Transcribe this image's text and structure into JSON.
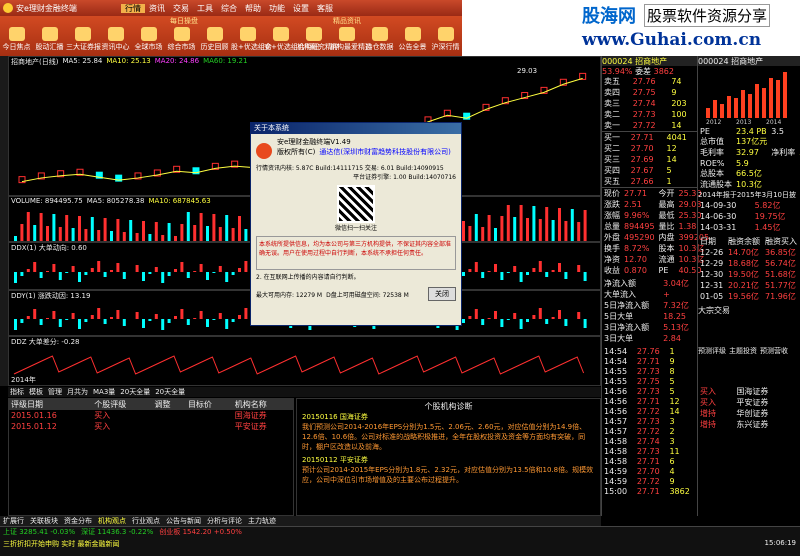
{
  "app": {
    "title": "安e理财金融终端",
    "menus": [
      "行情",
      "资讯",
      "交易",
      "工具",
      "综合",
      "帮助",
      "功能",
      "设置",
      "客服"
    ],
    "active_menu": "行情",
    "right_btns": [
      "交",
      "统",
      "云",
      "短",
      "网",
      "音"
    ]
  },
  "toolbar": {
    "sections": [
      "每日操盘",
      "精品资讯"
    ],
    "buttons": [
      "今日焦点",
      "股动汇播",
      "三大证券报",
      "资讯中心",
      "全球市场",
      "综合市场",
      "历史回顾",
      "股+优选组合",
      "安+优选组合明细",
      "机构研究精粹",
      "机构最爱精选",
      "持仓数据",
      "公告全景",
      "沪深行情"
    ]
  },
  "watermark": {
    "main": "股海网",
    "slogan": "股票软件资源分享",
    "url": "www.Guhai.com.cn"
  },
  "chart": {
    "stock": "招商地产(日线)",
    "ma": [
      "MA5: 25.84",
      "MA10: 25.13",
      "MA20: 24.86",
      "MA60: 19.21"
    ],
    "price_high": "29.03",
    "vol_label": "VOLUME: 894495.75",
    "vol_ma": [
      "MA5: 805278.38",
      "MA10: 687845.63"
    ],
    "ddx": "DDX(1) 大单动向: 0.60",
    "ddy": "DDY(1) 涨跌动因: 13.19",
    "ddz": "DDZ 大单差分: -0.28",
    "year": "2014年"
  },
  "chart_data": {
    "type": "line",
    "series": [
      {
        "name": "",
        "values": [
          15,
          15.5,
          15.8,
          16,
          15.6,
          15.2,
          15.5,
          15.9,
          16.4,
          16.2,
          16.8,
          17.1,
          16.9,
          17.5,
          18.2,
          18.8,
          18.5,
          19.4,
          20.5,
          21.2,
          22,
          23.1,
          24,
          23.6,
          24.8,
          25.7,
          26.4,
          27.1,
          28.2,
          29
        ]
      }
    ],
    "ylim": [
      14,
      30
    ]
  },
  "tabs": {
    "items": [
      "指标",
      "模板",
      "管理",
      "月共为",
      "MA3量",
      "20天全量",
      "20天全量"
    ]
  },
  "grid": {
    "headers": [
      "评级日期",
      "个股评级",
      "调整",
      "目标价",
      "机构名称"
    ],
    "rows": [
      [
        "2015.01.16",
        "买入",
        "",
        "",
        "国海证券"
      ],
      [
        "2015.01.12",
        "买入",
        "",
        "",
        "平安证券"
      ]
    ]
  },
  "report": {
    "header": "个股机构诊断",
    "items": [
      {
        "date": "20150116",
        "org": "国海证券",
        "text": "我们预测公司2014-2016年EPS分别为1.5元、2.06元、2.60元，对应估值分别为14.9倍、12.6倍、10.6倍。公司对标准的战略积极推进，全年在股权投资及资金等方面均有突破，同时，棚户区改造以及前海。"
      },
      {
        "date": "20150112",
        "org": "平安证券",
        "text": "预计公司2014-2015年EPS分别为1.8元、2.32元，对应估值分别为13.5倍和10.8倍。规模效应，公司中深位引市场增值及的主要公布过程提升。"
      }
    ]
  },
  "dialog": {
    "title": "关于本系统",
    "product": "安e理财金融终端V1.49",
    "version_label": "版权所有(C)",
    "company": "通达信(深圳市财富趋势科技股份有限公司)",
    "info": "行情资讯内核: 5.87C Build:14111715 交易: 6.01 Build:14090915",
    "platform": "平台证券引擎: 1.00 Build:14070716",
    "qr_label": "微信扫一扫关注",
    "legal": "本系统所提供信息，均为本公司与第三方机构提供，不保证其内容全部准确无误。用户在使用过程中自行判断，本系统不承担任何责任。",
    "notice": "2. 在互联网上传播的内容请自行判断。",
    "mem": "最大可用内存: 12279 M",
    "disk": "D盘上可用磁盘空间: 72538 M",
    "close_btn": "关闭"
  },
  "quote": {
    "code": "000024",
    "name": "招商地产",
    "price": "53.94%",
    "tag": "委差",
    "tag_val": "3862",
    "sell": [
      [
        "卖五",
        "27.76",
        "74"
      ],
      [
        "卖四",
        "27.75",
        "9"
      ],
      [
        "卖三",
        "27.74",
        "203"
      ],
      [
        "卖二",
        "27.73",
        "100"
      ],
      [
        "卖一",
        "27.72",
        "14"
      ]
    ],
    "buy": [
      [
        "买一",
        "27.71",
        "4041"
      ],
      [
        "买二",
        "27.70",
        "12"
      ],
      [
        "买三",
        "27.69",
        "14"
      ],
      [
        "买四",
        "27.67",
        "5"
      ],
      [
        "买五",
        "27.66",
        "1"
      ]
    ],
    "stats": [
      [
        "现价",
        "27.71",
        "今开",
        "25.30"
      ],
      [
        "涨跌",
        "2.51",
        "最高",
        "29.03"
      ],
      [
        "涨幅",
        "9.96%",
        "最低",
        "25.30"
      ],
      [
        "总量",
        "894495",
        "量比",
        "1.38"
      ],
      [
        "外盘",
        "495290",
        "内盘",
        "399205"
      ],
      [
        "换手",
        "8.72%",
        "股本",
        "10.3亿"
      ],
      [
        "净资",
        "12.70",
        "流通",
        "10.3亿"
      ],
      [
        "收益",
        "0.870",
        "PE",
        "40.50"
      ]
    ],
    "flow": [
      [
        "净流入额",
        "3.04亿"
      ],
      [
        "大单流入",
        "+"
      ],
      [
        "5日净流入额",
        "7.32亿"
      ],
      [
        "5日大单",
        "18.25"
      ],
      [
        "3日净流入额",
        "5.13亿"
      ],
      [
        "3日大单",
        "2.84"
      ]
    ]
  },
  "ticks": [
    [
      "14:54",
      "27.76",
      "1"
    ],
    [
      "14:54",
      "27.71",
      "9"
    ],
    [
      "14:55",
      "27.73",
      "8"
    ],
    [
      "14:55",
      "27.75",
      "5"
    ],
    [
      "14:56",
      "27.73",
      "5"
    ],
    [
      "14:56",
      "27.71",
      "12"
    ],
    [
      "14:56",
      "27.72",
      "14"
    ],
    [
      "14:57",
      "27.73",
      "3"
    ],
    [
      "14:57",
      "27.72",
      "2"
    ],
    [
      "14:58",
      "27.74",
      "3"
    ],
    [
      "14:58",
      "27.73",
      "11"
    ],
    [
      "14:58",
      "27.71",
      "6"
    ],
    [
      "14:59",
      "27.70",
      "4"
    ],
    [
      "14:59",
      "27.72",
      "9"
    ],
    [
      "15:00",
      "27.71",
      "3862"
    ]
  ],
  "fin": {
    "code": "000024",
    "name": "招商地产",
    "years": [
      "2012",
      "2013",
      "2014"
    ],
    "rows": [
      [
        "PE",
        "23.4 PB",
        "3.5"
      ],
      [
        "总市值",
        "137亿元"
      ],
      [
        "毛利率",
        "32.97",
        "净利率",
        "36"
      ],
      [
        "ROE%",
        "5.9"
      ],
      [
        "总股本",
        "66.5亿"
      ],
      [
        "流通股本",
        "10.3亿"
      ]
    ],
    "event": "2014年报于2015年3月10日披露",
    "table": [
      [
        "14-09-30",
        "5.82亿"
      ],
      [
        "14-06-30",
        "19.75亿"
      ],
      [
        "14-03-31",
        "1.45亿"
      ]
    ],
    "margin_headers": [
      "日期",
      "融资余额",
      "融资买入"
    ],
    "margin": [
      [
        "12-26",
        "14.70亿",
        "36.85亿"
      ],
      [
        "12-29",
        "18.68亿",
        "56.74亿"
      ],
      [
        "12-30",
        "19.50亿",
        "51.68亿"
      ],
      [
        "12-31",
        "20.21亿",
        "51.77亿"
      ],
      [
        "01-05",
        "19.56亿",
        "71.96亿"
      ]
    ],
    "holder": "大宗交易",
    "predict": [
      "预测评级",
      "主题投资",
      "预测营收"
    ],
    "ratings": [
      [
        "买入",
        "国海证券"
      ],
      [
        "买入",
        "平安证券"
      ],
      [
        "增持",
        "华创证券"
      ],
      [
        "增持",
        "东兴证券"
      ]
    ]
  },
  "bottom_tabs": [
    "扩展行",
    "关联板块",
    "资金分布",
    "机构观点",
    "行业观点",
    "公告与新闻",
    "分析与评论",
    "主力轨迹"
  ],
  "status": {
    "index": [
      [
        "上证",
        "3285.41",
        "-0.03%"
      ],
      [
        "深证",
        "11436.3",
        "-0.22%"
      ],
      [
        "创业板",
        "1542.20",
        "+0.50%"
      ]
    ],
    "news": "三折折扣开始申购 实时 最新金融新闻",
    "time": "15:06:19"
  }
}
